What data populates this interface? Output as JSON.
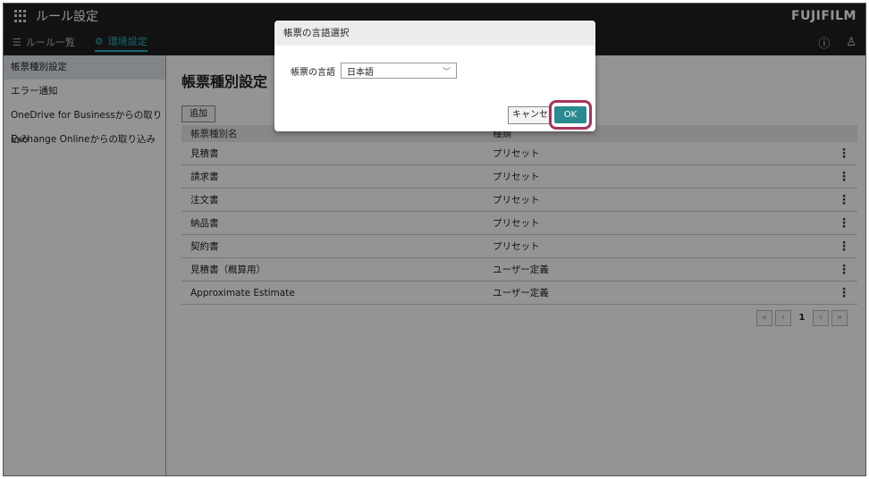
{
  "app": {
    "title": "ルール設定",
    "brand": "FUJIFILM"
  },
  "nav": {
    "tabs": [
      {
        "label": "ルール一覧",
        "icon": "list-icon"
      },
      {
        "label": "環境設定",
        "icon": "gear-icon"
      }
    ],
    "right": {
      "help_icon": "?",
      "user_icon": "user-icon"
    }
  },
  "sidebar": {
    "items": [
      {
        "label": "帳票種別設定"
      },
      {
        "label": "エラー通知"
      },
      {
        "label": "OneDrive for Businessからの取り込み"
      },
      {
        "label": "Exchange Onlineからの取り込み"
      }
    ]
  },
  "main": {
    "title": "帳票種別設定",
    "add_label": "追加",
    "columns": {
      "name": "帳票種別名",
      "type": "種類"
    },
    "rows": [
      {
        "name": "見積書",
        "type": "プリセット"
      },
      {
        "name": "請求書",
        "type": "プリセット"
      },
      {
        "name": "注文書",
        "type": "プリセット"
      },
      {
        "name": "納品書",
        "type": "プリセット"
      },
      {
        "name": "契約書",
        "type": "プリセット"
      },
      {
        "name": "見積書（概算用）",
        "type": "ユーザー定義"
      },
      {
        "name": "Approximate Estimate",
        "type": "ユーザー定義"
      }
    ],
    "menu_glyph": "⋮",
    "pager": {
      "first": "«",
      "prev": "‹",
      "page": "1",
      "next": "›",
      "last": "»"
    }
  },
  "dialog": {
    "title": "帳票の言語選択",
    "field_label": "帳票の言語",
    "selected": "日本語",
    "cancel_label": "キャンセル",
    "ok_label": "OK"
  },
  "colors": {
    "accent": "#2ab3bf",
    "ok_button": "#2a8a8f",
    "highlight": "#a8335f"
  }
}
